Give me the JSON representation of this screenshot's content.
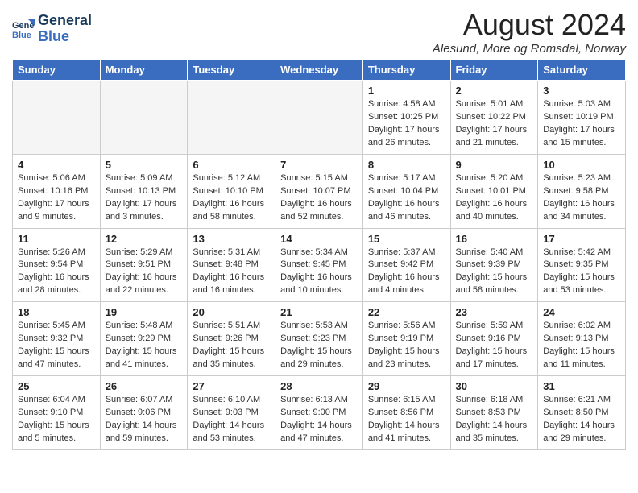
{
  "header": {
    "logo_line1": "General",
    "logo_line2": "Blue",
    "title": "August 2024",
    "subtitle": "Alesund, More og Romsdal, Norway"
  },
  "weekdays": [
    "Sunday",
    "Monday",
    "Tuesday",
    "Wednesday",
    "Thursday",
    "Friday",
    "Saturday"
  ],
  "weeks": [
    [
      {
        "day": "",
        "info": ""
      },
      {
        "day": "",
        "info": ""
      },
      {
        "day": "",
        "info": ""
      },
      {
        "day": "",
        "info": ""
      },
      {
        "day": "1",
        "info": "Sunrise: 4:58 AM\nSunset: 10:25 PM\nDaylight: 17 hours\nand 26 minutes."
      },
      {
        "day": "2",
        "info": "Sunrise: 5:01 AM\nSunset: 10:22 PM\nDaylight: 17 hours\nand 21 minutes."
      },
      {
        "day": "3",
        "info": "Sunrise: 5:03 AM\nSunset: 10:19 PM\nDaylight: 17 hours\nand 15 minutes."
      }
    ],
    [
      {
        "day": "4",
        "info": "Sunrise: 5:06 AM\nSunset: 10:16 PM\nDaylight: 17 hours\nand 9 minutes."
      },
      {
        "day": "5",
        "info": "Sunrise: 5:09 AM\nSunset: 10:13 PM\nDaylight: 17 hours\nand 3 minutes."
      },
      {
        "day": "6",
        "info": "Sunrise: 5:12 AM\nSunset: 10:10 PM\nDaylight: 16 hours\nand 58 minutes."
      },
      {
        "day": "7",
        "info": "Sunrise: 5:15 AM\nSunset: 10:07 PM\nDaylight: 16 hours\nand 52 minutes."
      },
      {
        "day": "8",
        "info": "Sunrise: 5:17 AM\nSunset: 10:04 PM\nDaylight: 16 hours\nand 46 minutes."
      },
      {
        "day": "9",
        "info": "Sunrise: 5:20 AM\nSunset: 10:01 PM\nDaylight: 16 hours\nand 40 minutes."
      },
      {
        "day": "10",
        "info": "Sunrise: 5:23 AM\nSunset: 9:58 PM\nDaylight: 16 hours\nand 34 minutes."
      }
    ],
    [
      {
        "day": "11",
        "info": "Sunrise: 5:26 AM\nSunset: 9:54 PM\nDaylight: 16 hours\nand 28 minutes."
      },
      {
        "day": "12",
        "info": "Sunrise: 5:29 AM\nSunset: 9:51 PM\nDaylight: 16 hours\nand 22 minutes."
      },
      {
        "day": "13",
        "info": "Sunrise: 5:31 AM\nSunset: 9:48 PM\nDaylight: 16 hours\nand 16 minutes."
      },
      {
        "day": "14",
        "info": "Sunrise: 5:34 AM\nSunset: 9:45 PM\nDaylight: 16 hours\nand 10 minutes."
      },
      {
        "day": "15",
        "info": "Sunrise: 5:37 AM\nSunset: 9:42 PM\nDaylight: 16 hours\nand 4 minutes."
      },
      {
        "day": "16",
        "info": "Sunrise: 5:40 AM\nSunset: 9:39 PM\nDaylight: 15 hours\nand 58 minutes."
      },
      {
        "day": "17",
        "info": "Sunrise: 5:42 AM\nSunset: 9:35 PM\nDaylight: 15 hours\nand 53 minutes."
      }
    ],
    [
      {
        "day": "18",
        "info": "Sunrise: 5:45 AM\nSunset: 9:32 PM\nDaylight: 15 hours\nand 47 minutes."
      },
      {
        "day": "19",
        "info": "Sunrise: 5:48 AM\nSunset: 9:29 PM\nDaylight: 15 hours\nand 41 minutes."
      },
      {
        "day": "20",
        "info": "Sunrise: 5:51 AM\nSunset: 9:26 PM\nDaylight: 15 hours\nand 35 minutes."
      },
      {
        "day": "21",
        "info": "Sunrise: 5:53 AM\nSunset: 9:23 PM\nDaylight: 15 hours\nand 29 minutes."
      },
      {
        "day": "22",
        "info": "Sunrise: 5:56 AM\nSunset: 9:19 PM\nDaylight: 15 hours\nand 23 minutes."
      },
      {
        "day": "23",
        "info": "Sunrise: 5:59 AM\nSunset: 9:16 PM\nDaylight: 15 hours\nand 17 minutes."
      },
      {
        "day": "24",
        "info": "Sunrise: 6:02 AM\nSunset: 9:13 PM\nDaylight: 15 hours\nand 11 minutes."
      }
    ],
    [
      {
        "day": "25",
        "info": "Sunrise: 6:04 AM\nSunset: 9:10 PM\nDaylight: 15 hours\nand 5 minutes."
      },
      {
        "day": "26",
        "info": "Sunrise: 6:07 AM\nSunset: 9:06 PM\nDaylight: 14 hours\nand 59 minutes."
      },
      {
        "day": "27",
        "info": "Sunrise: 6:10 AM\nSunset: 9:03 PM\nDaylight: 14 hours\nand 53 minutes."
      },
      {
        "day": "28",
        "info": "Sunrise: 6:13 AM\nSunset: 9:00 PM\nDaylight: 14 hours\nand 47 minutes."
      },
      {
        "day": "29",
        "info": "Sunrise: 6:15 AM\nSunset: 8:56 PM\nDaylight: 14 hours\nand 41 minutes."
      },
      {
        "day": "30",
        "info": "Sunrise: 6:18 AM\nSunset: 8:53 PM\nDaylight: 14 hours\nand 35 minutes."
      },
      {
        "day": "31",
        "info": "Sunrise: 6:21 AM\nSunset: 8:50 PM\nDaylight: 14 hours\nand 29 minutes."
      }
    ]
  ]
}
